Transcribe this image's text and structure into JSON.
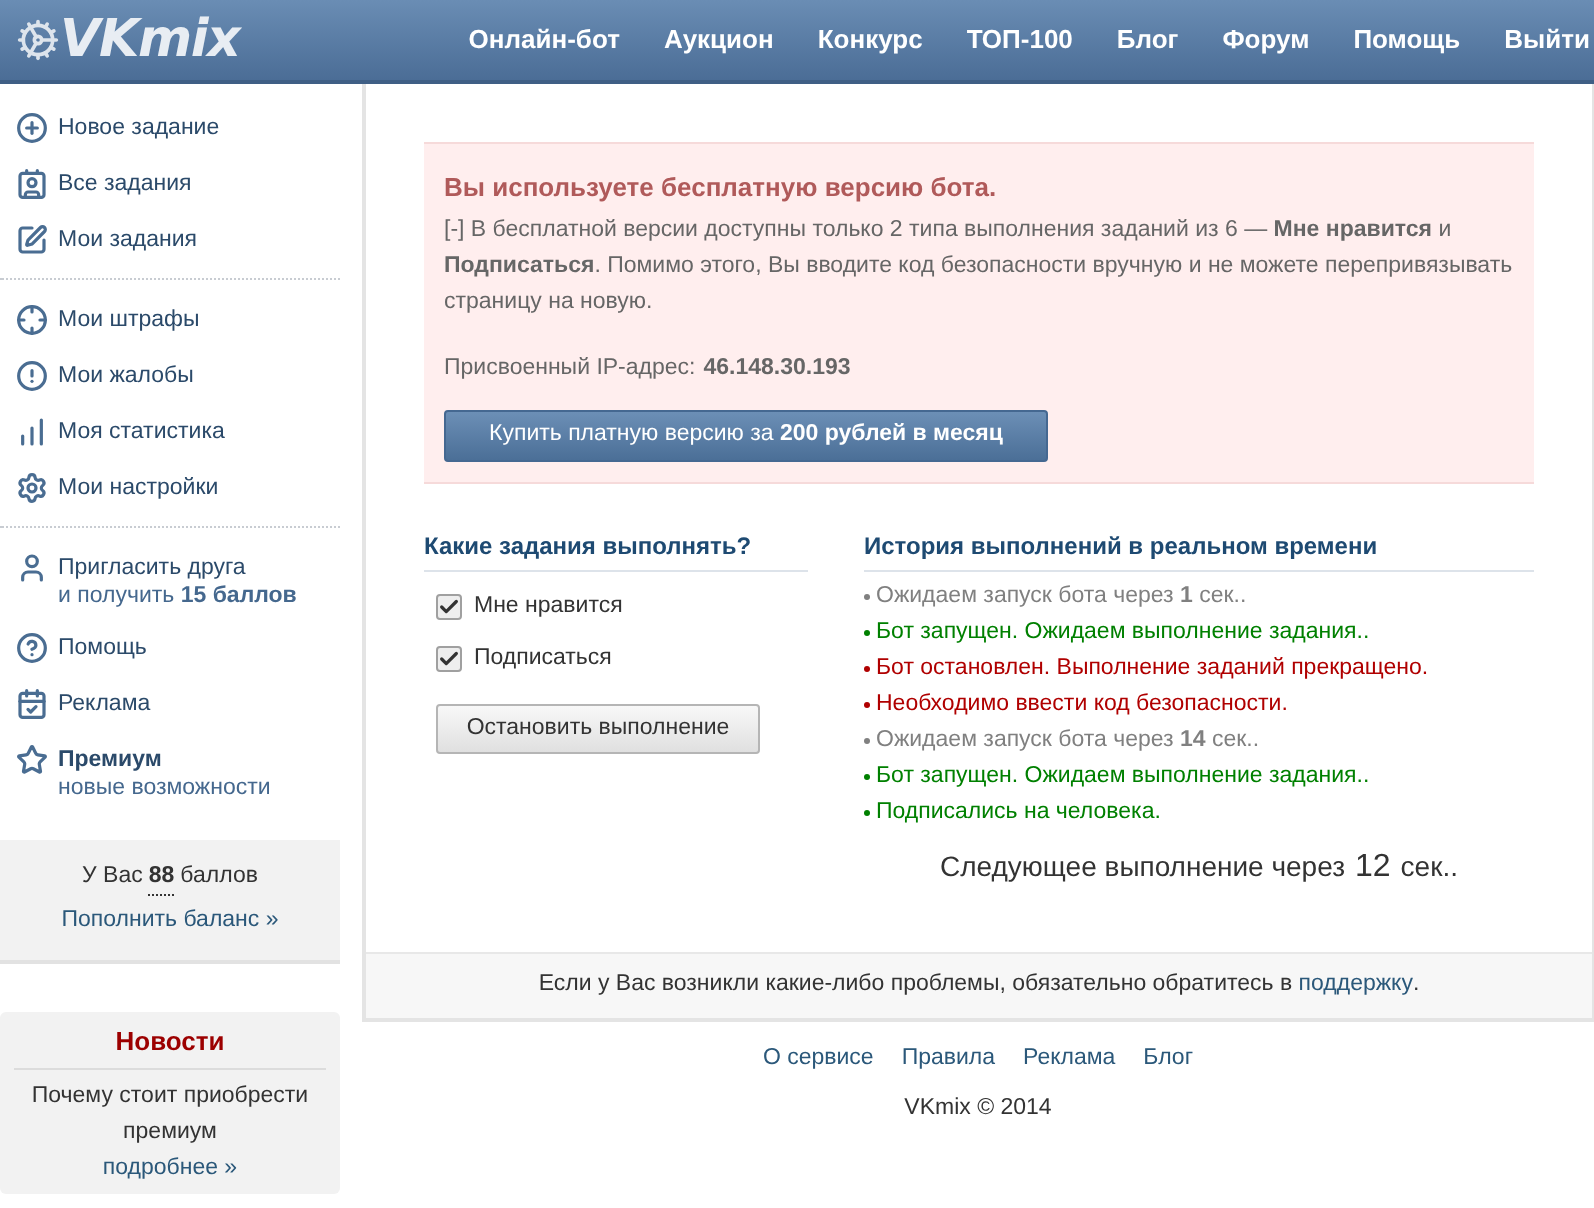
{
  "header": {
    "logo": "VKmix",
    "nav": [
      {
        "label": "Онлайн-бот"
      },
      {
        "label": "Аукцион"
      },
      {
        "label": "Конкурс"
      },
      {
        "label": "ТОП-100"
      },
      {
        "label": "Блог"
      },
      {
        "label": "Форум"
      },
      {
        "label": "Помощь"
      },
      {
        "label": "Выйти"
      }
    ]
  },
  "sidebar": {
    "groups": [
      {
        "items": [
          {
            "label": "Новое задание"
          },
          {
            "label": "Все задания"
          },
          {
            "label": "Мои задания"
          }
        ]
      },
      {
        "items": [
          {
            "label": "Мои штрафы"
          },
          {
            "label": "Мои жалобы"
          },
          {
            "label": "Моя статистика"
          },
          {
            "label": "Мои настройки"
          }
        ]
      },
      {
        "items": [
          {
            "label": "Пригласить друга",
            "subtitle": "и получить **15 баллов**"
          },
          {
            "label": "Помощь"
          },
          {
            "label": "Реклама"
          },
          {
            "label": "Премиум",
            "subtitle": "новые возможности",
            "bold": true
          }
        ]
      }
    ],
    "balance": {
      "prefix": "У Вас",
      "points": "88",
      "suffix": "баллов",
      "link": "Пополнить баланс »"
    },
    "news": {
      "title": "Новости",
      "text": "Почему стоит приобрести премиум",
      "link": "подробнее »"
    }
  },
  "notice": {
    "title": "Вы используете бесплатную версию бота.",
    "text": "[-] В бесплатной версии доступны только 2 типа выполнения заданий из 6 — **Мне нравится** и **Подписаться**. Помимо этого, Вы вводите код безопасности вручную и не можете перепривязывать страницу на новую.",
    "ip_label": "Присвоенный IP-адрес:",
    "ip": "46.148.30.193",
    "button": "Купить платную версию за **200 рублей в месяц**"
  },
  "tasks": {
    "title": "Какие задания выполнять?",
    "options": [
      {
        "label": "Мне нравится",
        "checked": true
      },
      {
        "label": "Подписаться",
        "checked": true
      }
    ],
    "button": "Остановить выполнение"
  },
  "history": {
    "title": "История выполнений в реальном времени",
    "items": [
      {
        "text": "Ожидаем запуск бота через **1** сек..",
        "color": "#808080"
      },
      {
        "text": "Бот запущен. Ожидаем выполнение задания..",
        "color": "#008000"
      },
      {
        "text": "Бот остановлен. Выполнение заданий прекращено.",
        "color": "#b00000"
      },
      {
        "text": "Необходимо ввести код безопасности.",
        "color": "#b00000"
      },
      {
        "text": "Ожидаем запуск бота через **14** сек..",
        "color": "#808080"
      },
      {
        "text": "Бот запущен. Ожидаем выполнение задания..",
        "color": "#008000"
      },
      {
        "text": "Подписались на человека.",
        "color": "#008000"
      }
    ],
    "next_prefix": "Следующее выполнение через",
    "next_value": "12",
    "next_suffix": "сек.."
  },
  "support": {
    "text": "Если у Вас возникли какие-либо проблемы, обязательно обратитесь в",
    "link": "поддержку",
    "end": "."
  },
  "footer": {
    "links": [
      {
        "label": "О сервисе"
      },
      {
        "label": "Правила"
      },
      {
        "label": "Реклама"
      },
      {
        "label": "Блог"
      }
    ],
    "copyright": "VKmix © 2014"
  }
}
